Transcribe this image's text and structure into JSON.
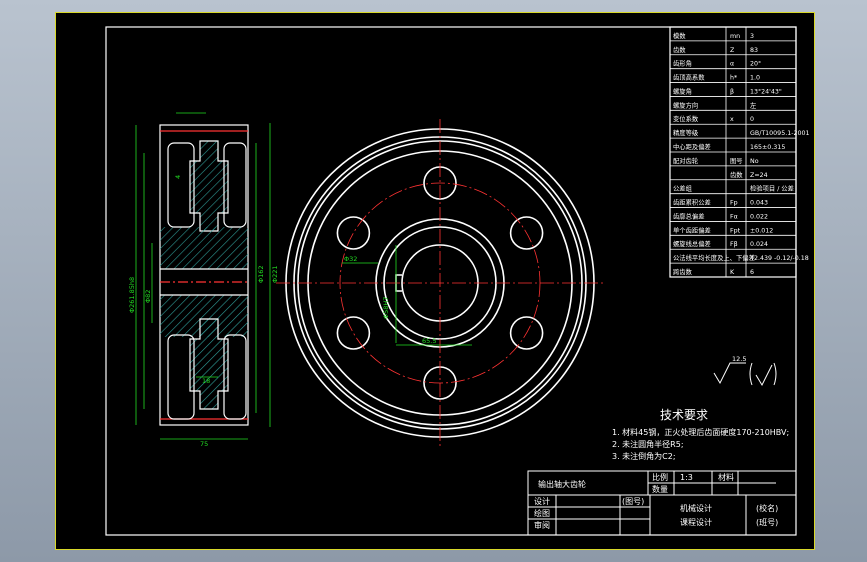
{
  "colors": {
    "background": "#000000",
    "outline": "#ffffff",
    "dimension": "#22dd22",
    "center_line": "#ff3333",
    "hatch": "#2f9c98",
    "frame_accent": "#d9d92a"
  },
  "params": [
    {
      "name": "模数",
      "sym": "mn",
      "val": "3"
    },
    {
      "name": "齿数",
      "sym": "Z",
      "val": "83"
    },
    {
      "name": "齿形角",
      "sym": "α",
      "val": "20°"
    },
    {
      "name": "齿顶高系数",
      "sym": "h*",
      "val": "1.0"
    },
    {
      "name": "螺旋角",
      "sym": "β",
      "val": "13°24'43\""
    },
    {
      "name": "螺旋方向",
      "sym": "",
      "val": "左"
    },
    {
      "name": "变位系数",
      "sym": "x",
      "val": "0"
    },
    {
      "name": "精度等级",
      "sym": "",
      "val": "GB/T10095.1-2001"
    },
    {
      "name": "中心距及偏差",
      "sym": "",
      "val": "165±0.315"
    },
    {
      "name": "配对齿轮",
      "sym": "图号",
      "val": "No"
    },
    {
      "name": "",
      "sym": "齿数",
      "val": "Z=24"
    },
    {
      "name": "公差组",
      "sym": "",
      "val": "检验项目 / 公差"
    },
    {
      "name": "齿距累积公差",
      "sym": "Fp",
      "val": "0.043"
    },
    {
      "name": "齿廓总偏差",
      "sym": "Fα",
      "val": "0.022"
    },
    {
      "name": "单个齿距偏差",
      "sym": "Fpt",
      "val": "±0.012"
    },
    {
      "name": "螺旋线总偏差",
      "sym": "Fβ",
      "val": "0.024"
    },
    {
      "name": "公法线平均长度及上、下偏差",
      "sym": "",
      "val": "42.439 -0.12/-0.18"
    },
    {
      "name": "跨齿数",
      "sym": "K",
      "val": "6"
    }
  ],
  "tech": {
    "title": "技术要求",
    "lines": [
      "1. 材料45钢，正火处理后齿面硬度170-210HBV;",
      "2. 未注圆角半径R5;",
      "3. 未注倒角为C2;"
    ]
  },
  "roughness": "12.5",
  "title_block": {
    "part_name": "输出轴大齿轮",
    "scale_label": "比例",
    "scale_value": "1:3",
    "material_label": "材料",
    "qty_label": "数量",
    "drawing_no_label": "(图号)",
    "design_label": "设计",
    "drawn_label": "绘图",
    "review_label": "审阅",
    "course1": "机械设计",
    "course2": "课程设计",
    "school": "(校名)",
    "class": "(班号)"
  },
  "dims": {
    "width": "75",
    "hub_len": "18",
    "d1": "Φ162",
    "d2": "Φ221",
    "da": "Φ261.85h8",
    "d3": "Φ82",
    "bore": "Φ58H7",
    "key": "65.5",
    "hole": "Φ32",
    "chamfer": "4"
  }
}
